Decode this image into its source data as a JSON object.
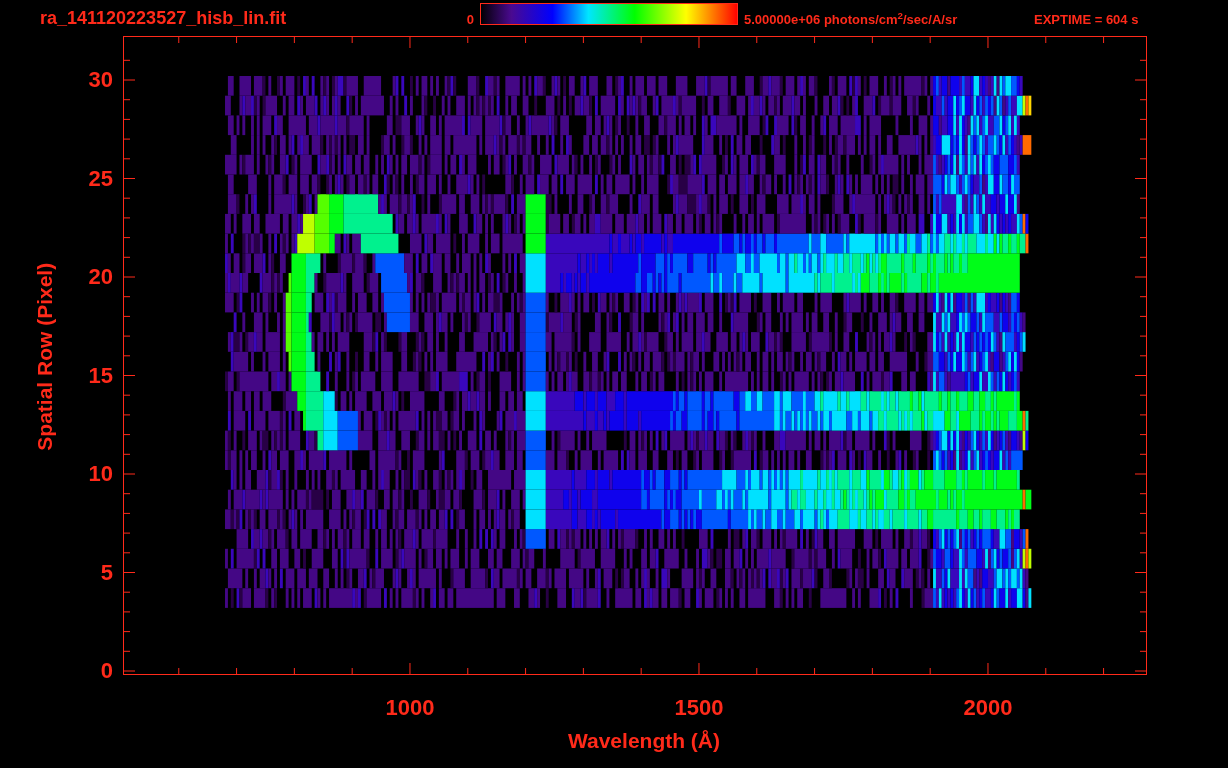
{
  "header": {
    "title": "ra_141120223527_hisb_lin.fit",
    "colorbar": {
      "min_label": "0",
      "max_label": "5.00000e+06 photons/cm$^{2}$/sec/A/sr"
    },
    "exposure": "EXPTIME = 604 s"
  },
  "plot": {
    "xlabel": "Wavelength (Å)",
    "ylabel": "Spatial Row (Pixel)",
    "xticks": [
      "1000",
      "1500",
      "2000"
    ],
    "yticks": [
      "30",
      "25",
      "20",
      "15",
      "10",
      "5",
      "0"
    ]
  }
}
